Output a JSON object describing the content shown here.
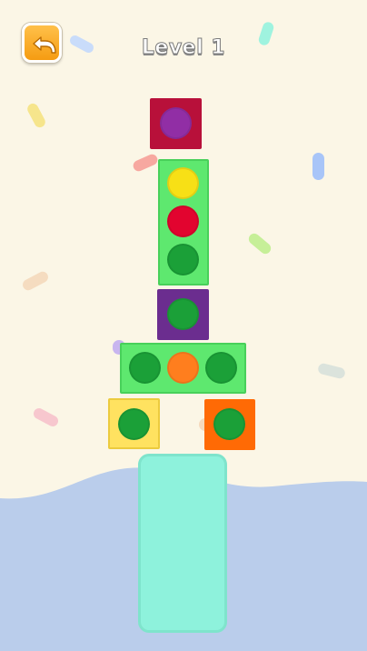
{
  "header": {
    "level_title": "Level 1",
    "back_icon": "undo-arrow-icon"
  },
  "colors": {
    "background": "#fbf6e6",
    "water": "#bacdeb",
    "platform": "#8ef2dc",
    "green_block": "#5ee86f",
    "green_dot": "#1ba038",
    "yellow_dot": "#f7e016",
    "red_dot": "#e2042f",
    "orange_dot": "#ff7e1e",
    "purple_dot": "#912ea5",
    "crimson_block": "#b8103a",
    "purple_block": "#6b2d8f",
    "yellow_block": "#ffe260",
    "orange_block": "#ff6a05"
  },
  "stack": [
    {
      "name": "crimson-block",
      "color": "crimson",
      "dots": [
        "purple"
      ]
    },
    {
      "name": "green-vertical-block",
      "color": "green",
      "dots": [
        "yellow",
        "red",
        "green"
      ]
    },
    {
      "name": "purple-block",
      "color": "purple",
      "dots": [
        "green"
      ]
    },
    {
      "name": "green-horizontal-block",
      "color": "green",
      "dots": [
        "green",
        "orange",
        "green"
      ]
    },
    {
      "name": "yellow-block",
      "color": "yellow",
      "dots": [
        "green"
      ]
    },
    {
      "name": "orange-block",
      "color": "orange",
      "dots": [
        "green"
      ]
    }
  ]
}
